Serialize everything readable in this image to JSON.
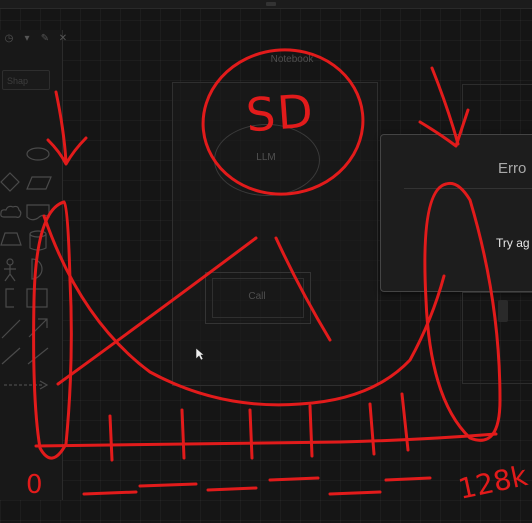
{
  "canvas": {
    "notebook_title": "Notebook",
    "llm_label": "LLM",
    "call_label": "Call",
    "search_placeholder": "Shap"
  },
  "error_panel": {
    "title": "Erro",
    "try_again_label": "Try ag"
  },
  "annotations": {
    "circled_text": "SD",
    "axis_start_label": "0",
    "axis_end_label": "128k"
  },
  "colors": {
    "annotation_red": "#e21b1b",
    "canvas_bg": "#151515",
    "panel_border": "#444444"
  }
}
